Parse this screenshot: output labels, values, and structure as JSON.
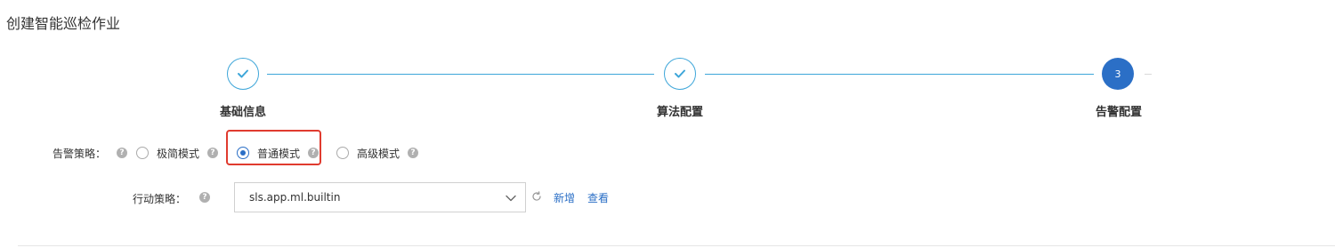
{
  "page": {
    "title": "创建智能巡检作业"
  },
  "steps": [
    {
      "label": "基础信息",
      "status": "done"
    },
    {
      "label": "算法配置",
      "status": "done"
    },
    {
      "label": "告警配置",
      "status": "current",
      "number": "3"
    }
  ],
  "alert_policy": {
    "label": "告警策略：",
    "options": [
      {
        "label": "极简模式",
        "checked": false
      },
      {
        "label": "普通模式",
        "checked": true
      },
      {
        "label": "高级模式",
        "checked": false
      }
    ]
  },
  "action_policy": {
    "label": "行动策略：",
    "selected_value": "sls.app.ml.builtin",
    "add_link": "新增",
    "view_link": "查看"
  },
  "icons": {
    "help": "help-question-icon",
    "check": "check-icon",
    "dropdown": "chevron-down-icon",
    "refresh": "refresh-icon"
  },
  "colors": {
    "primary": "#2b6fc6",
    "step_done": "#3ea6d9",
    "highlight": "#e03b2f"
  }
}
